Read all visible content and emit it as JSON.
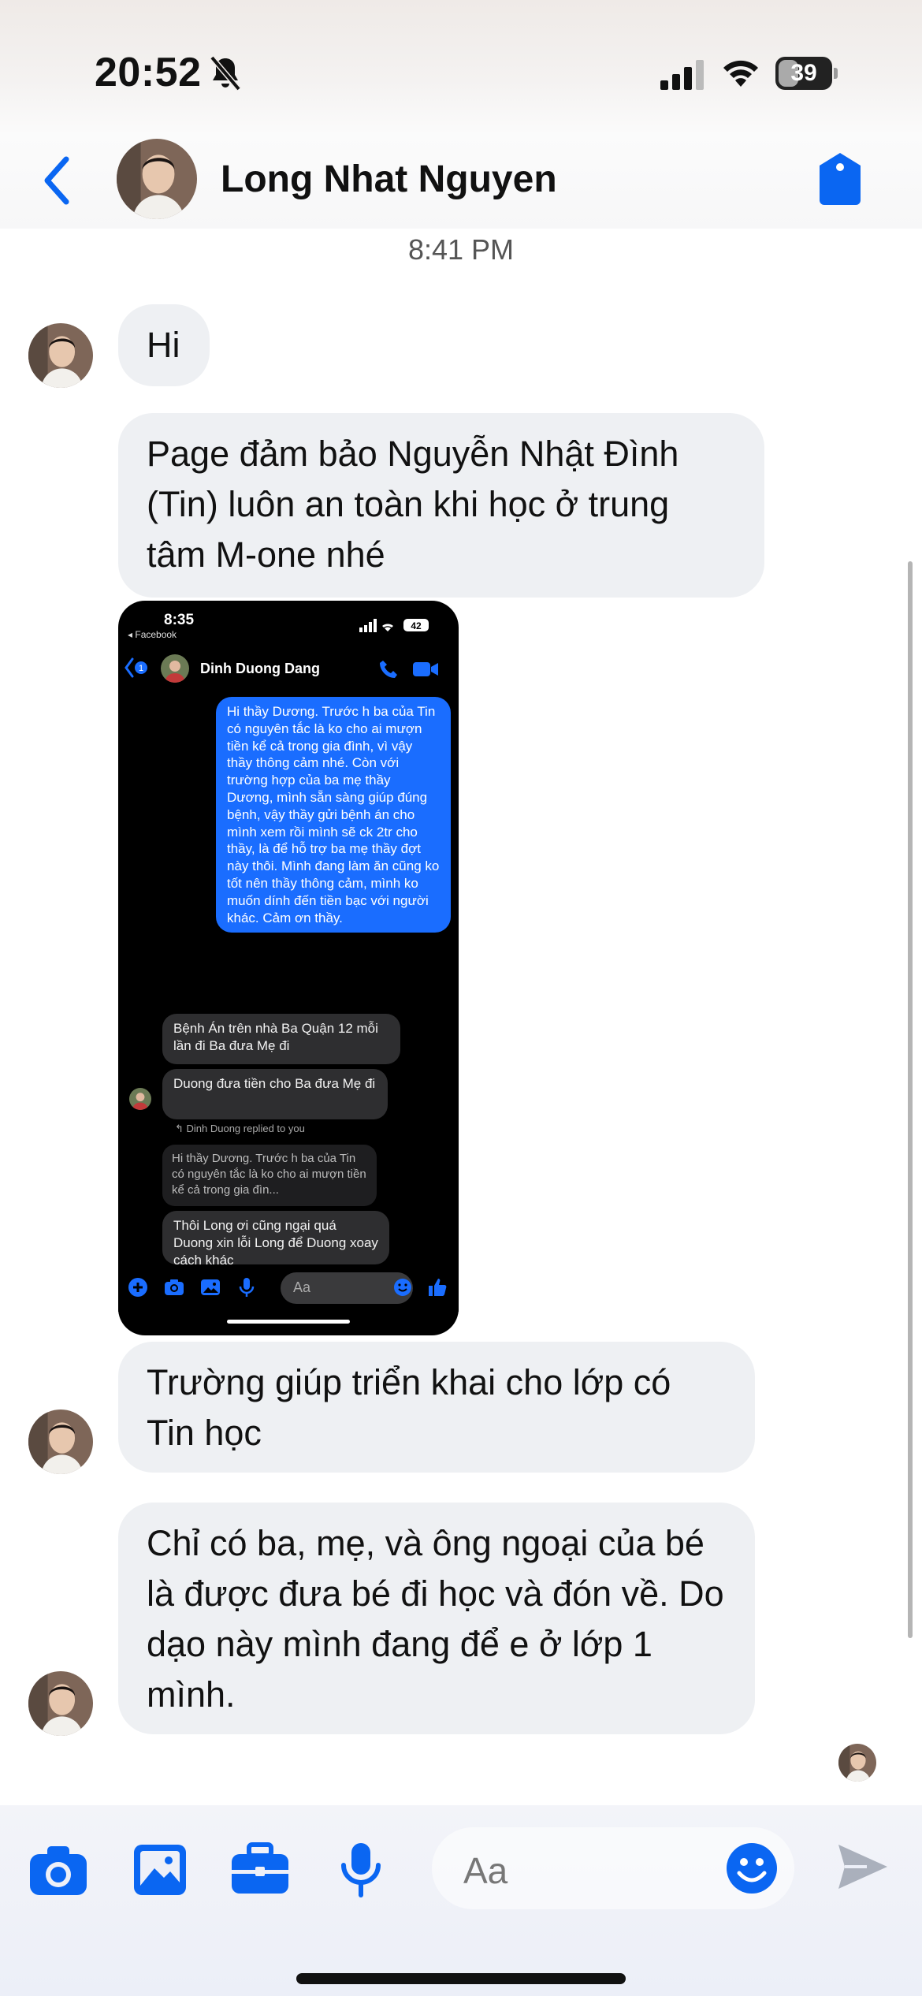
{
  "status_bar": {
    "time": "20:52",
    "battery": "39",
    "battery_level": 0.39
  },
  "header": {
    "contact_name": "Long Nhat Nguyen"
  },
  "thread": {
    "timestamp": "8:41 PM",
    "messages": [
      {
        "text": "Hi"
      },
      {
        "text": "Page đảm bảo Nguyễn Nhật Đình (Tin) luôn an toàn khi học ở trung tâm M-one nhé"
      },
      {
        "text": "Trường giúp triển khai cho lớp có Tin học"
      },
      {
        "text": "Chỉ có ba, mẹ, và ông ngoại của bé là được đưa bé đi học và đón về. Do dạo này mình đang để e ở lớp 1 mình."
      }
    ]
  },
  "embedded_screenshot": {
    "time": "8:35",
    "source": "◂ Facebook",
    "battery": "42",
    "back_badge": "1",
    "contact": "Dinh Duong Dang",
    "outgoing": "Hi thầy Dương. Trước h ba của Tin có nguyên tắc là ko cho ai mượn tiền kể cả trong gia đình, vì vậy thầy thông cảm nhé. Còn với trường hợp của ba mẹ thầy Dương, mình sẵn sàng giúp đúng bệnh, vậy thầy gửi bệnh án cho mình xem rồi mình sẽ ck 2tr cho thầy, là để hỗ trợ ba mẹ thầy đợt này thôi. Mình đang làm ăn cũng ko tốt nên thầy thông cảm, mình ko muốn dính đến tiền bạc với người khác. Cảm ơn thầy.",
    "incoming_1": "Bệnh Án trên nhà Ba Quận 12 mỗi lần đi Ba đưa Mẹ đi",
    "incoming_2": "Duong đưa tiền cho Ba đưa Mẹ đi",
    "reply_header": "↰ Dinh Duong replied to you",
    "quoted": "Hi thầy Dương. Trước h ba của Tin có nguyên tắc là ko cho ai mượn tiền kể cả trong gia đìn...",
    "incoming_3": "Thôi Long ơi cũng ngại quá Duong xin lỗi Long để Duong xoay cách khác",
    "input_placeholder": "Aa"
  },
  "composer": {
    "placeholder": "Aa"
  },
  "colors": {
    "accent": "#0a66f2",
    "bubble": "#eef0f3",
    "text": "#111111"
  },
  "icons": [
    "back-chevron-icon",
    "tag-icon",
    "camera-icon",
    "photo-icon",
    "briefcase-icon",
    "microphone-icon",
    "emoji-icon",
    "send-icon",
    "bell-slash-icon",
    "signal-icon",
    "wifi-icon"
  ]
}
